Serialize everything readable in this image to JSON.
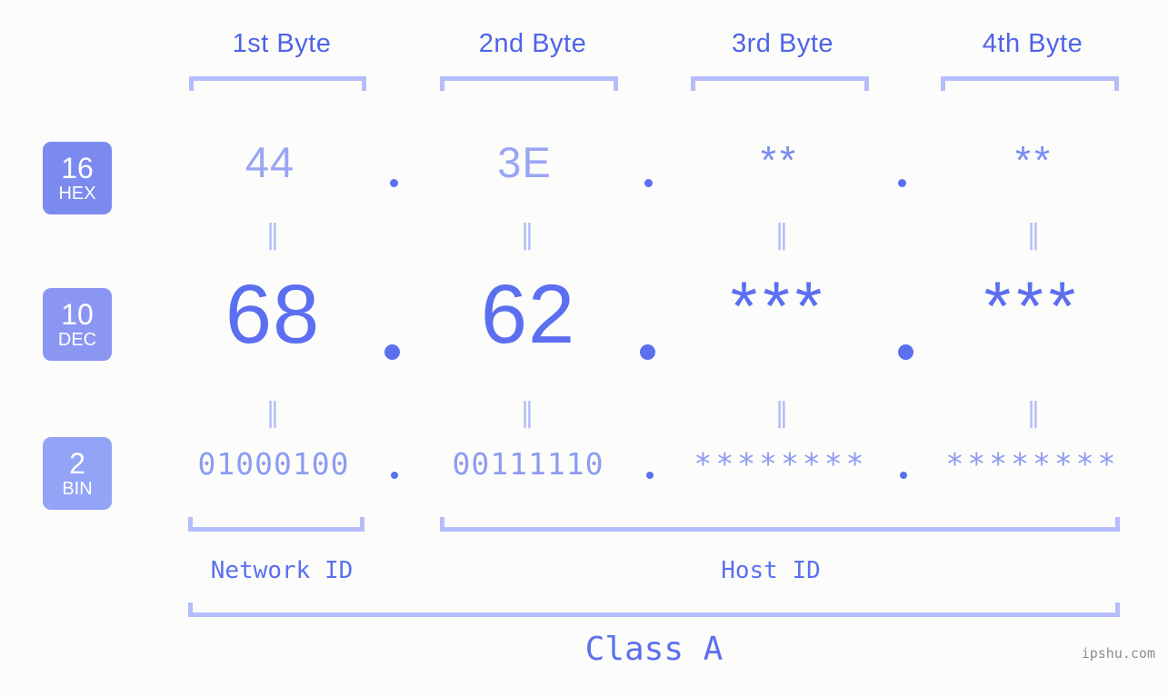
{
  "background_color": "#fcfdfa",
  "accent_color": "#5b6ff0",
  "bracket_color": "#b5bdfb",
  "headers": {
    "byte1": "1st Byte",
    "byte2": "2nd Byte",
    "byte3": "3rd Byte",
    "byte4": "4th Byte"
  },
  "bases": [
    {
      "number": "16",
      "abbr": "HEX",
      "color": "#7b8aef"
    },
    {
      "number": "10",
      "abbr": "DEC",
      "color": "#8b96f2"
    },
    {
      "number": "2",
      "abbr": "BIN",
      "color": "#93a3f5"
    }
  ],
  "rows": {
    "hex": {
      "byte1": "44",
      "byte2": "3E",
      "byte3": "**",
      "byte4": "**"
    },
    "dec": {
      "byte1": "68",
      "byte2": "62",
      "byte3": "***",
      "byte4": "***"
    },
    "bin": {
      "byte1": "01000100",
      "byte2": "00111110",
      "byte3": "********",
      "byte4": "********"
    }
  },
  "separators": {
    "equality": "‖",
    "dot": "."
  },
  "sections": {
    "network_id": "Network ID",
    "host_id": "Host ID",
    "class": "Class A"
  },
  "watermark": "ipshu.com"
}
